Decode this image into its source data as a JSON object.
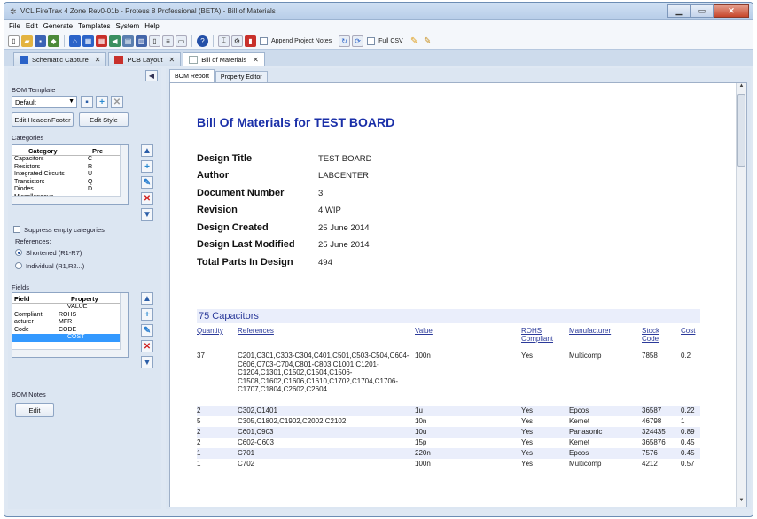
{
  "window": {
    "title": "VCL FireTrax 4 Zone Rev0-01b - Proteus 8 Professional (BETA) - Bill of Materials"
  },
  "menu": [
    "File",
    "Edit",
    "Generate",
    "Templates",
    "System",
    "Help"
  ],
  "toolbar": {
    "append_notes_label": "Append Project Notes",
    "full_csv_label": "Full CSV"
  },
  "doc_tabs": [
    {
      "label": "Schematic Capture",
      "color": "#2b63c8"
    },
    {
      "label": "PCB Layout",
      "color": "#c8302b"
    },
    {
      "label": "Bill of Materials",
      "color": "#e8c44a"
    }
  ],
  "left": {
    "bom_template_label": "BOM Template",
    "template_selected": "Default",
    "edit_header_footer": "Edit Header/Footer",
    "edit_style": "Edit Style",
    "categories_label": "Categories",
    "categories_columns": [
      "Category",
      "Pre"
    ],
    "categories": [
      {
        "name": "Capacitors",
        "prefix": "C"
      },
      {
        "name": "Resistors",
        "prefix": "R"
      },
      {
        "name": "Integrated Circuits",
        "prefix": "U"
      },
      {
        "name": "Transistors",
        "prefix": "Q"
      },
      {
        "name": "Diodes",
        "prefix": "D"
      },
      {
        "name": "Miscellaneous",
        "prefix": ""
      }
    ],
    "suppress_label": "Suppress empty categories",
    "references_label": "References:",
    "ref_short": "Shortened (R1-R7)",
    "ref_individual": "Individual (R1,R2...)",
    "fields_label": "Fields",
    "fields_columns": [
      "Field",
      "Property"
    ],
    "fields": [
      {
        "field": "",
        "property": "VALUE"
      },
      {
        "field": "Compliant",
        "property": "ROHS"
      },
      {
        "field": "acturer",
        "property": "MFR"
      },
      {
        "field": "Code",
        "property": "CODE"
      },
      {
        "field": "",
        "property": "COST"
      }
    ],
    "bom_notes_label": "BOM Notes",
    "edit_label": "Edit"
  },
  "subtabs": [
    "BOM Report",
    "Property Editor"
  ],
  "report": {
    "title": "Bill Of Materials for TEST BOARD",
    "info": [
      {
        "key": "Design Title",
        "value": "TEST BOARD"
      },
      {
        "key": "Author",
        "value": "LABCENTER"
      },
      {
        "key": "Document Number",
        "value": "3"
      },
      {
        "key": "Revision",
        "value": "4 WIP"
      },
      {
        "key": "Design Created",
        "value": "25 June 2014"
      },
      {
        "key": "Design Last Modified",
        "value": "25 June 2014"
      },
      {
        "key": "Total Parts In Design",
        "value": "494"
      }
    ],
    "category_heading": "75 Capacitors",
    "columns": {
      "quantity": "Quantity",
      "references": "References",
      "value": "Value",
      "rohs": "ROHS Compliant",
      "manufacturer": "Manufacturer",
      "stock": "Stock Code",
      "cost": "Cost"
    },
    "rows": [
      {
        "qty": "37",
        "refs": "C201,C301,C303-C304,C401,C501,C503-C504,C604-C606,C703-C704,C801-C803,C1001,C1201-C1204,C1301,C1502,C1504,C1506-C1508,C1602,C1606,C1610,C1702,C1704,C1706-C1707,C1804,C2602,C2604",
        "value": "100n",
        "rohs": "Yes",
        "mfr": "Multicomp",
        "stock": "7858",
        "cost": "0.2"
      },
      {
        "qty": "2",
        "refs": "C302,C1401",
        "value": "1u",
        "rohs": "Yes",
        "mfr": "Epcos",
        "stock": "36587",
        "cost": "0.22"
      },
      {
        "qty": "5",
        "refs": "C305,C1802,C1902,C2002,C2102",
        "value": "10n",
        "rohs": "Yes",
        "mfr": "Kemet",
        "stock": "46798",
        "cost": "1"
      },
      {
        "qty": "2",
        "refs": "C601,C903",
        "value": "10u",
        "rohs": "Yes",
        "mfr": "Panasonic",
        "stock": "324435",
        "cost": "0.89"
      },
      {
        "qty": "2",
        "refs": "C602-C603",
        "value": "15p",
        "rohs": "Yes",
        "mfr": "Kemet",
        "stock": "365876",
        "cost": "0.45"
      },
      {
        "qty": "1",
        "refs": "C701",
        "value": "220n",
        "rohs": "Yes",
        "mfr": "Epcos",
        "stock": "7576",
        "cost": "0.45"
      },
      {
        "qty": "1",
        "refs": "C702",
        "value": "100n",
        "rohs": "Yes",
        "mfr": "Multicomp",
        "stock": "4212",
        "cost": "0.57"
      }
    ]
  }
}
